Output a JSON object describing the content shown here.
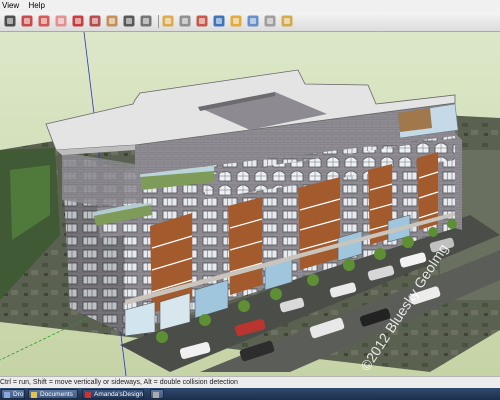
{
  "menu": {
    "items": [
      "View",
      "Help"
    ]
  },
  "toolbar": {
    "buttons": [
      {
        "icon": "select-arrow-icon",
        "color": "#333333"
      },
      {
        "icon": "orbit-icon",
        "color": "#c03030"
      },
      {
        "icon": "paint-bucket-icon",
        "color": "#d04040"
      },
      {
        "icon": "eraser-icon",
        "color": "#e08080"
      },
      {
        "icon": "move-icon",
        "color": "#c02020"
      },
      {
        "icon": "rotate-icon",
        "color": "#b03030"
      },
      {
        "icon": "pan-hand-icon",
        "color": "#c08040"
      },
      {
        "icon": "zoom-icon",
        "color": "#404040"
      },
      {
        "icon": "zoom-extents-icon",
        "color": "#606060"
      },
      {
        "icon": "folder-open-icon",
        "color": "#d8a030"
      },
      {
        "icon": "components-icon",
        "color": "#808080"
      },
      {
        "icon": "section-plane-icon",
        "color": "#c04030"
      },
      {
        "icon": "layers-icon",
        "color": "#2060b0"
      },
      {
        "icon": "styles-icon",
        "color": "#e0a020"
      },
      {
        "icon": "extensions-icon",
        "color": "#5080c0"
      },
      {
        "icon": "shadows-icon",
        "color": "#909090"
      },
      {
        "icon": "geo-location-icon",
        "color": "#d0a030"
      }
    ]
  },
  "watermark": "©2012 Bluesky GeoImg",
  "status_text": "Ctrl = run, Shift = move vertically or sideways, Alt = double collision detection",
  "taskbar": {
    "items": [
      {
        "label": "Dro...",
        "active": false,
        "icon_color": "#88aadd"
      },
      {
        "label": "Documents",
        "active": false,
        "icon_color": "#e8c050"
      },
      {
        "label": "Amanda'sDesign - S...",
        "active": true,
        "icon_color": "#d03030"
      },
      {
        "label": "",
        "active": false,
        "icon_color": "#aaaaaa"
      }
    ]
  }
}
